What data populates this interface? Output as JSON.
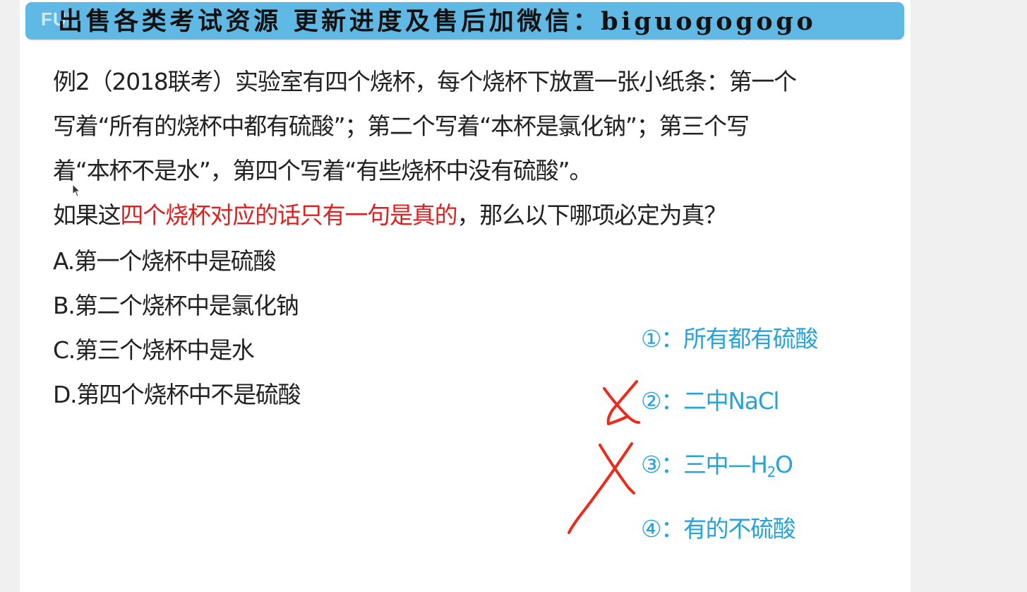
{
  "banner": {
    "logo": "FUI",
    "text": "出售各类考试资源 更新进度及售后加微信：biguogogogo"
  },
  "question": {
    "lines": [
      "例2（2018联考）实验室有四个烧杯，每个烧杯下放置一张小纸条：第一个",
      "写着“所有的烧杯中都有硫酸”；第二个写着“本杯是氯化钠”；第三个写",
      "着“本杯不是水”，第四个写着“有些烧杯中没有硫酸”。"
    ],
    "condition_prefix": "如果这",
    "condition_highlight": "四个烧杯对应的话只有一句是真的",
    "condition_suffix": "，那么以下哪项必定为真？"
  },
  "options": [
    "A.第一个烧杯中是硫酸",
    "B.第二个烧杯中是氯化钠",
    "C.第三个烧杯中是水",
    "D.第四个烧杯中不是硫酸"
  ],
  "notes": {
    "n1": "①：所有都有硫酸",
    "n2": "②：二中NaCl",
    "n3_prefix": "③：三中—H",
    "n3_sub": "2",
    "n3_suffix": "O",
    "n4": "④：有的不硫酸"
  },
  "colors": {
    "banner": "#5fb9e4",
    "highlight": "#e02020",
    "notes": "#27a3dc",
    "ink": "#ee2a1b"
  }
}
